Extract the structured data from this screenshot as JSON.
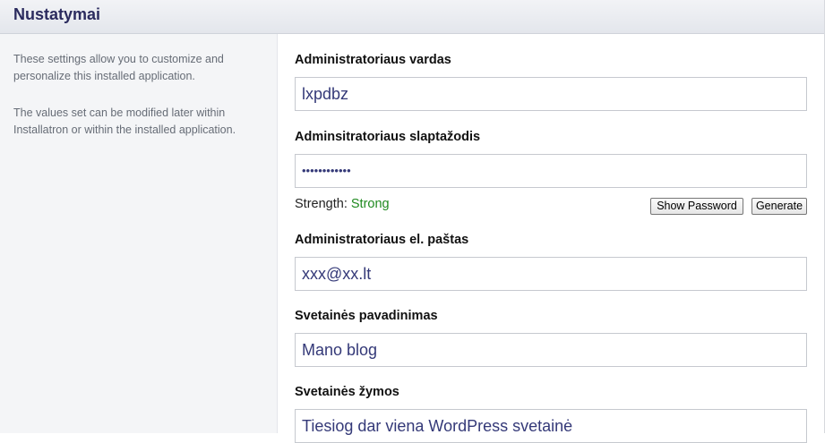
{
  "header": {
    "title": "Nustatymai"
  },
  "sidebar": {
    "paragraph1": "These settings allow you to customize and personalize this installed application.",
    "paragraph2": "The values set can be modified later within Installatron or within the installed application."
  },
  "form": {
    "admin_name": {
      "label": "Administratoriaus vardas",
      "value": "lxpdbz"
    },
    "admin_password": {
      "label": "Adminsitratoriaus slaptažodis",
      "value": "••••••••••••",
      "strength_label": "Strength:",
      "strength_value": "Strong",
      "strength_color": "#1f8a1f",
      "show_password_button": "Show Password",
      "generate_button": "Generate"
    },
    "admin_email": {
      "label": "Administratoriaus el. paštas",
      "value": "xxx@xx.lt"
    },
    "site_name": {
      "label": "Svetainės pavadinimas",
      "value": "Mano blog"
    },
    "site_tagline": {
      "label": "Svetainės žymos",
      "value": "Tiesiog dar viena WordPress svetainė"
    }
  }
}
